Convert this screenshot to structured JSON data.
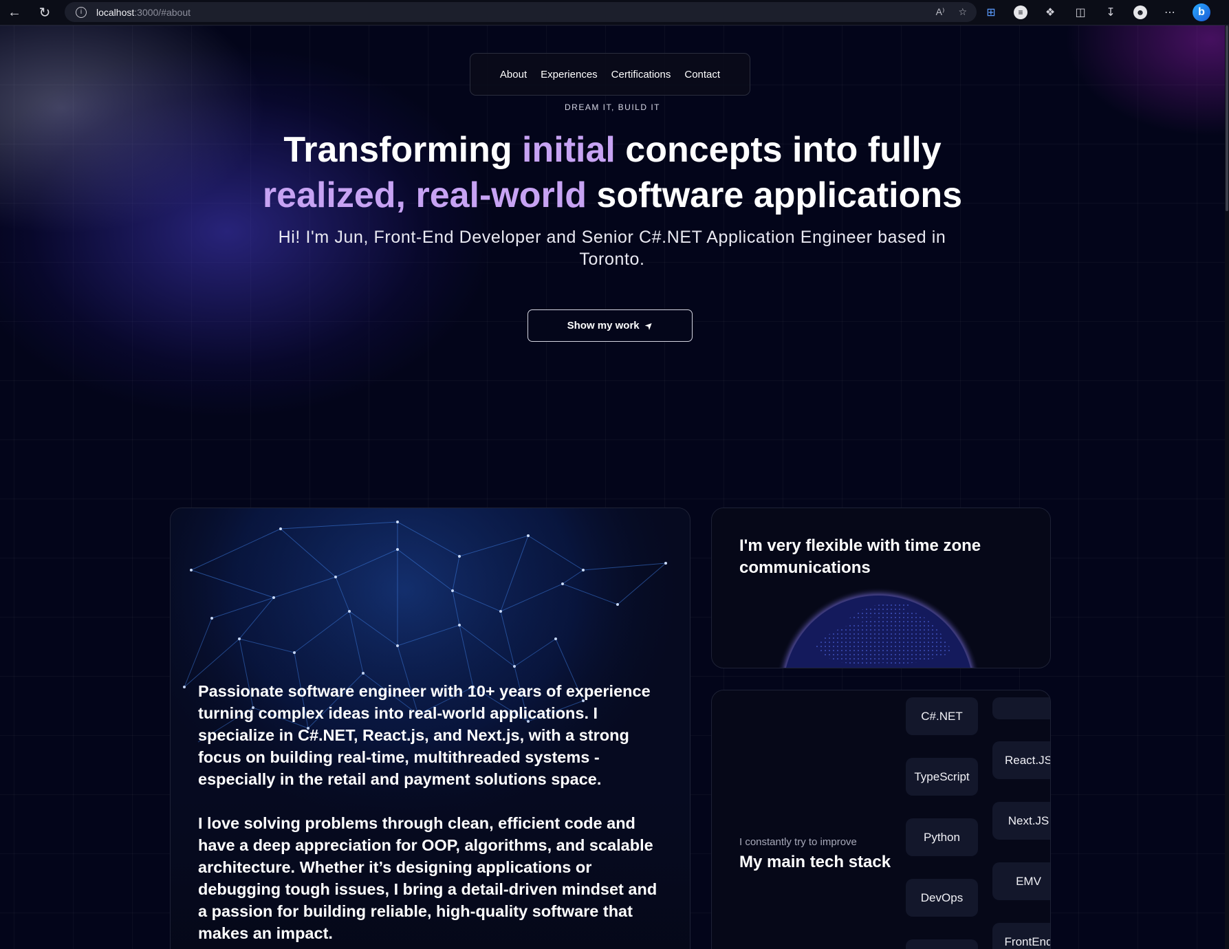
{
  "browser": {
    "url_host": "localhost",
    "url_path": ":3000/#about",
    "read_aloud_label": "A⁾"
  },
  "nav": {
    "items": [
      "About",
      "Experiences",
      "Certifications",
      "Contact"
    ]
  },
  "hero": {
    "eyebrow": "DREAM IT, BUILD IT",
    "headline": {
      "part1": "Transforming ",
      "part2": "initial",
      "part3": " concepts into fully",
      "part4": "realized, real-world",
      "part5": " software applications"
    },
    "subtitle": "Hi! I'm Jun, Front-End Developer and Senior C#.NET Application Engineer based in Toronto.",
    "cta_label": "Show my work"
  },
  "bio": {
    "paragraph1": "Passionate software engineer with 10+ years of experience turning complex ideas into real-world applications. I specialize in C#.NET, React.js, and Next.js, with a strong focus on building real-time, multithreaded systems - especially in the retail and payment solutions space.",
    "paragraph2": "I love solving problems through clean, efficient code and have a deep appreciation for OOP, algorithms, and scalable architecture. Whether it’s designing applications or debugging tough issues, I bring a detail-driven mindset and a passion for building reliable, high-quality software that makes an impact."
  },
  "timezone_card": {
    "title": "I'm very flexible with time zone communications"
  },
  "tech_stack": {
    "kicker": "I constantly try to improve",
    "title": "My main tech stack",
    "left_column": [
      "C#.NET",
      "TypeScript",
      "Python",
      "DevOps",
      ""
    ],
    "right_column": [
      "",
      "React.JS",
      "Next.JS",
      "EMV",
      "FrontEnd"
    ]
  },
  "colors": {
    "background": "#03051a",
    "accent_purple": "#c7a3f3",
    "card_border": "#1e2236",
    "pill_bg": "#13172b"
  }
}
